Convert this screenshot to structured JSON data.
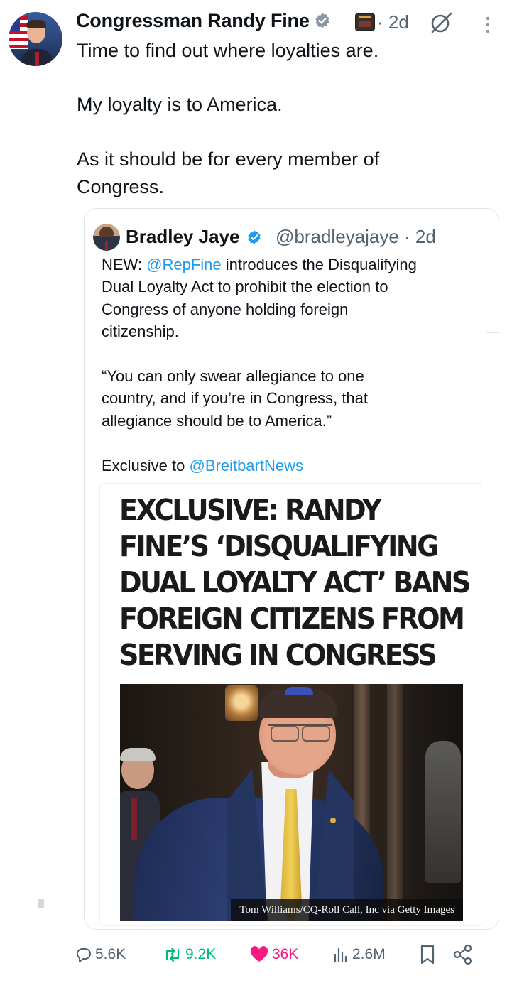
{
  "tweet": {
    "author_name": "Congressman Randy Fine",
    "timestamp": "· 2d",
    "body_lines": [
      "Time to find out where loyalties are.",
      "My loyalty is to America.",
      "As it should be for every member of",
      "Congress."
    ],
    "avatar_icon": "profile-photo-flag",
    "verified_icon": "verified-badge-icon",
    "affiliation_icon": "affiliation-badge-icon",
    "grok_icon": "grok-icon",
    "more_icon": "more-dots-icon"
  },
  "quoted_tweet": {
    "author_name": "Bradley Jaye",
    "handle_and_time": "@bradleyajaye · 2d",
    "line1_prefix": "NEW: ",
    "line1_mention": "@RepFine",
    "line1_suffix": " introduces the Disqualifying",
    "line2": "Dual Loyalty Act  to prohibit the election to",
    "line3": "Congress of anyone holding foreign",
    "line4": "citizenship.",
    "quote1": "“You can only swear allegiance to one",
    "quote2": "country, and if you’re in Congress, that",
    "quote3": "allegiance should be to America.”",
    "exclusive_prefix": "Exclusive to ",
    "exclusive_mention": "@BreitbartNews"
  },
  "article": {
    "headline_lines": [
      "EXCLUSIVE: RANDY",
      "FINE’S ‘DISQUALIFYING",
      "DUAL LOYALTY ACT’ BANS",
      "FOREIGN CITIZENS FROM",
      "SERVING IN CONGRESS"
    ],
    "photo_credit": "Tom Williams/CQ-Roll Call, Inc via Getty Images"
  },
  "actions": {
    "replies": "5.6K",
    "retweets": "9.2K",
    "likes": "36K",
    "views": "2.6M",
    "reply_icon": "reply-icon",
    "retweet_icon": "retweet-icon",
    "like_icon": "heart-icon",
    "views_icon": "views-chart-icon",
    "bookmark_icon": "bookmark-icon",
    "share_icon": "share-icon"
  },
  "colors": {
    "link": "#1d9bf0",
    "retweet": "#00ba7c",
    "like": "#f91880",
    "muted": "#536471",
    "verified": "#1d9bf0"
  }
}
